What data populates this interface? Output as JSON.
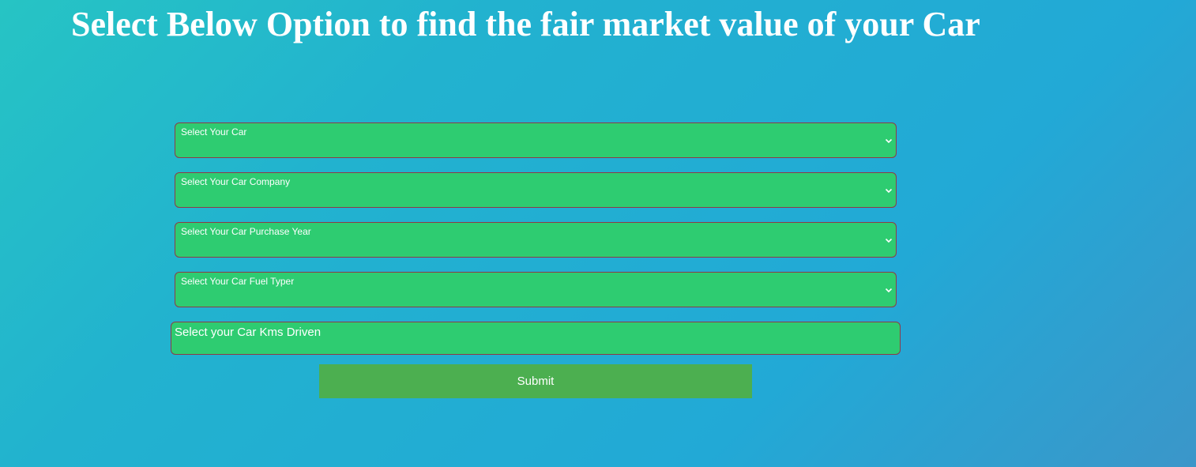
{
  "page": {
    "title": "Select Below Option to find the fair market value of your Car"
  },
  "form": {
    "car_select": {
      "selected": "Select Your Car"
    },
    "company_select": {
      "selected": "Select Your Car Company"
    },
    "year_select": {
      "selected": "Select Your Car Purchase Year"
    },
    "fuel_select": {
      "selected": "Select Your Car Fuel Typer"
    },
    "kms_input": {
      "placeholder": "Select your Car Kms Driven"
    },
    "submit_label": "Submit"
  },
  "colors": {
    "field_background": "#2ecc71",
    "field_border": "#8e3b46",
    "button_background": "#4caf50",
    "text": "#ffffff"
  },
  "icons": {
    "select_arrow": "chevron-down-icon"
  }
}
